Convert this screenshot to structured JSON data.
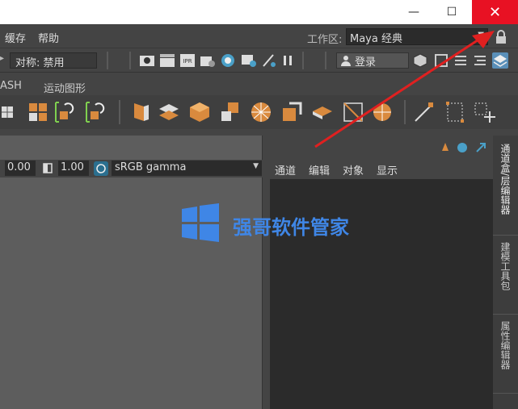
{
  "menubar": {
    "items": [
      "缓存",
      "帮助"
    ],
    "workspace_label": "工作区:",
    "workspace_value": "Maya 经典"
  },
  "statusline": {
    "symmetry_value": "对称: 禁用",
    "login_label": "登录"
  },
  "shelf_tabs": [
    "ASH",
    "运动图形"
  ],
  "viewport_toolbar": {
    "gamma": "0.00",
    "exposure": "1.00",
    "colorspace": "sRGB gamma"
  },
  "outliner": {
    "menu": [
      "通道",
      "编辑",
      "对象",
      "显示"
    ]
  },
  "right_tabs": [
    "通道盒/层编辑器",
    "建模工具包",
    "属性编辑器"
  ],
  "watermark": {
    "text": "强哥软件管家"
  },
  "colors": {
    "close_button": "#e81123",
    "annotation_arrow": "#e02020",
    "watermark_blue": "#3f86e6",
    "shelf_orange": "#d98a3e"
  }
}
